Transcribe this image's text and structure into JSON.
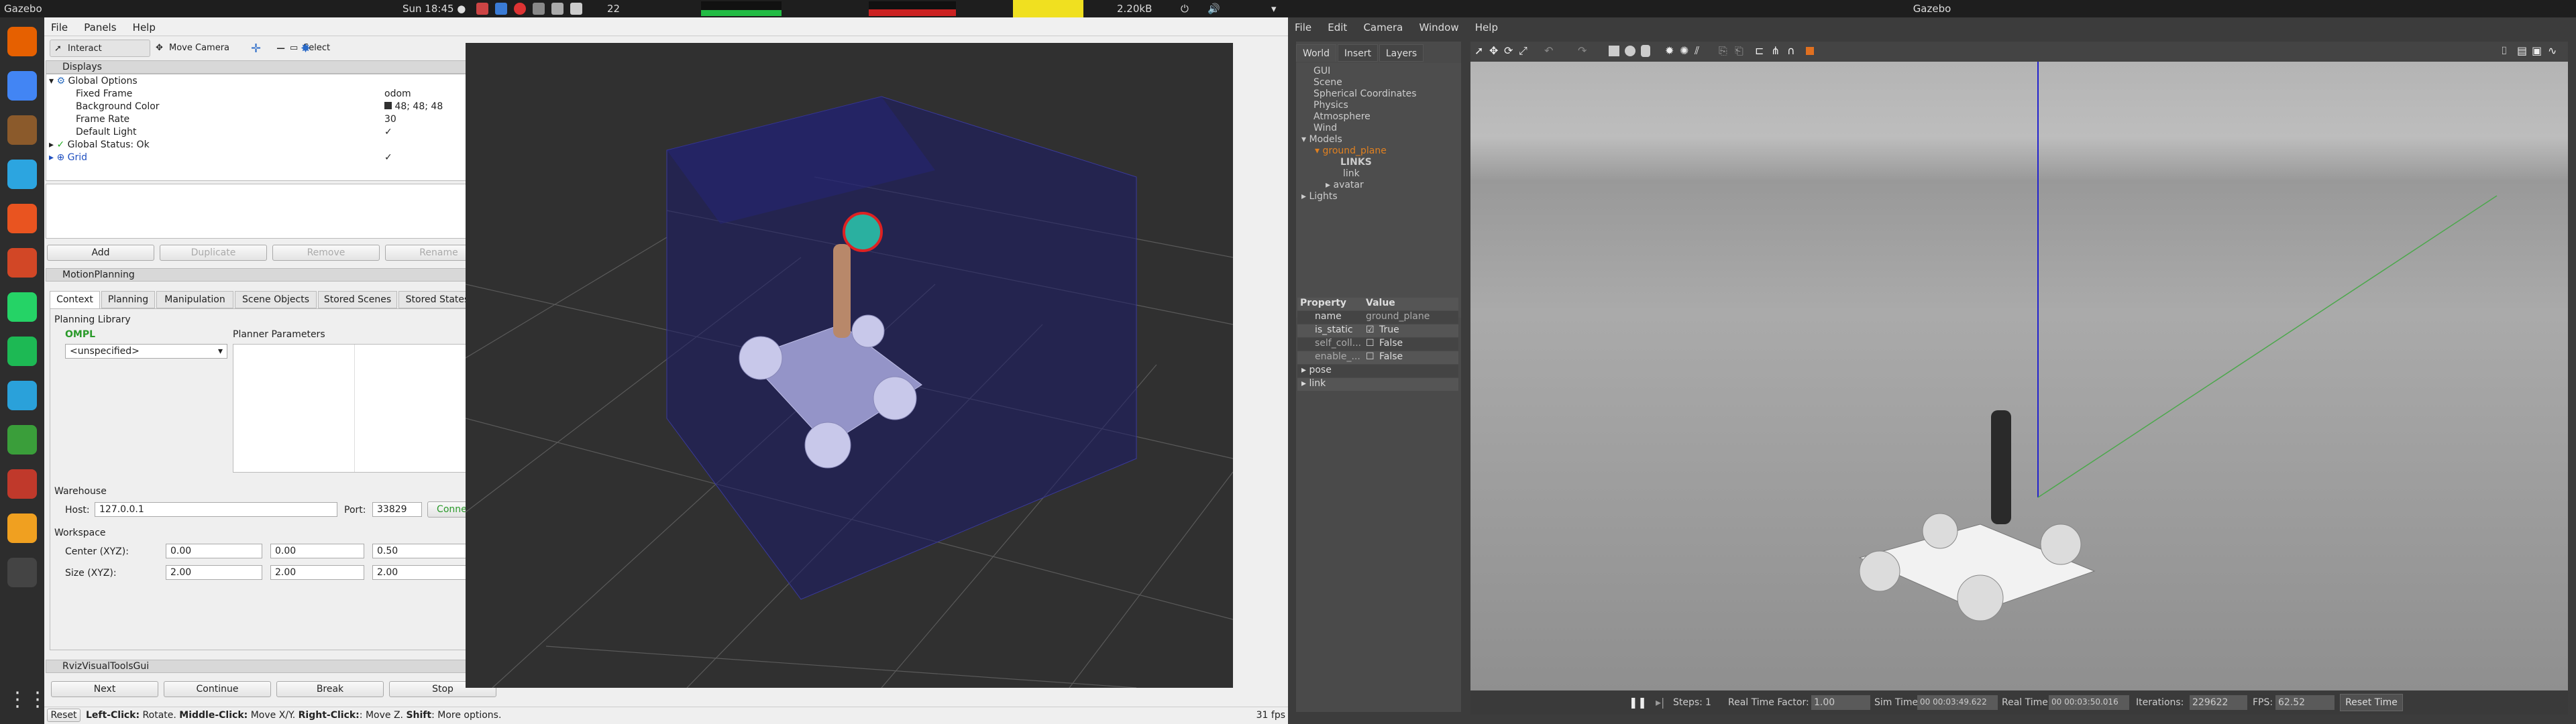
{
  "system_bar": {
    "app_name": "Gazebo",
    "clock": "Sun 18:45 ●",
    "network_speed": "2.20kB",
    "workspace_number": "22"
  },
  "dock": {
    "items": [
      "firefox",
      "chrome",
      "files",
      "mail",
      "software",
      "settings",
      "whatsapp",
      "spotify",
      "telegram",
      "app-green",
      "terminal",
      "layers",
      "rviz",
      "apps"
    ],
    "colors": [
      "#e66000",
      "#4285f4",
      "#8b5a2b",
      "#2ca5e0",
      "#e95420",
      "#d24726",
      "#25d366",
      "#1db954",
      "#2aa1da",
      "#3a9e3a",
      "#c0392b",
      "#f0a020",
      "#444444",
      "#666666"
    ]
  },
  "rviz": {
    "menu": [
      "File",
      "Panels",
      "Help"
    ],
    "toolbar": [
      "Interact",
      "Move Camera",
      "Select"
    ],
    "displays": {
      "title": "Displays",
      "rows": [
        {
          "name": "Global Options",
          "value": ""
        },
        {
          "name": "Fixed Frame",
          "value": "odom"
        },
        {
          "name": "Background Color",
          "value": "48; 48; 48"
        },
        {
          "name": "Frame Rate",
          "value": "30"
        },
        {
          "name": "Default Light",
          "value": "✓"
        },
        {
          "name": "Global Status: Ok",
          "value": ""
        },
        {
          "name": "Grid",
          "value": "✓"
        }
      ],
      "buttons": [
        "Add",
        "Duplicate",
        "Remove",
        "Rename"
      ]
    },
    "motion_planning": {
      "title": "MotionPlanning",
      "tabs": [
        "Context",
        "Planning",
        "Manipulation",
        "Scene Objects",
        "Stored Scenes",
        "Stored States"
      ],
      "planning_library": "Planning Library",
      "library_name": "OMPL",
      "planner_select": "<unspecified>",
      "planner_params": "Planner Parameters",
      "warehouse": "Warehouse",
      "host_label": "Host:",
      "host_value": "127.0.0.1",
      "port_label": "Port:",
      "port_value": "33829",
      "connect": "Connect",
      "workspace": "Workspace",
      "center_label": "Center (XYZ):",
      "center": [
        "0.00",
        "0.00",
        "0.50"
      ],
      "size_label": "Size (XYZ):",
      "size": [
        "2.00",
        "2.00",
        "2.00"
      ]
    },
    "visual_tools": {
      "title": "RvizVisualToolsGui",
      "buttons": [
        "Next",
        "Continue",
        "Break",
        "Stop"
      ]
    },
    "status": {
      "reset": "Reset",
      "help_1": "Left-Click:",
      "help_1v": " Rotate. ",
      "help_2": "Middle-Click:",
      "help_2v": " Move X/Y. ",
      "help_3": "Right-Click:",
      "help_3v": ": Move Z. ",
      "help_4": "Shift",
      "help_4v": ": More options.",
      "fps": "31 fps"
    }
  },
  "gazebo": {
    "title": "Gazebo",
    "menu": [
      "File",
      "Edit",
      "Camera",
      "Window",
      "Help"
    ],
    "tabs": [
      "World",
      "Insert",
      "Layers"
    ],
    "tree": [
      "GUI",
      "Scene",
      "Spherical Coordinates",
      "Physics",
      "Atmosphere",
      "Wind",
      "Models",
      "ground_plane",
      "LINKS",
      "link",
      "avatar",
      "Lights"
    ],
    "prop_header": [
      "Property",
      "Value"
    ],
    "props": [
      {
        "k": "name",
        "v": "ground_plane"
      },
      {
        "k": "is_static",
        "v": "True"
      },
      {
        "k": "self_coll...",
        "v": "False"
      },
      {
        "k": "enable_...",
        "v": "False"
      },
      {
        "k": "pose",
        "v": ""
      },
      {
        "k": "link",
        "v": ""
      }
    ],
    "bottom": {
      "steps_label": "Steps:",
      "steps_value": "1",
      "rtf_label": "Real Time Factor:",
      "rtf_value": "1.00",
      "sim_label": "Sim Time:",
      "sim_value": "00 00:03:49.622",
      "real_label": "Real Time:",
      "real_value": "00 00:03:50.016",
      "iter_label": "Iterations:",
      "iter_value": "229622",
      "fps_label": "FPS:",
      "fps_value": "62.52",
      "reset": "Reset Time"
    }
  }
}
